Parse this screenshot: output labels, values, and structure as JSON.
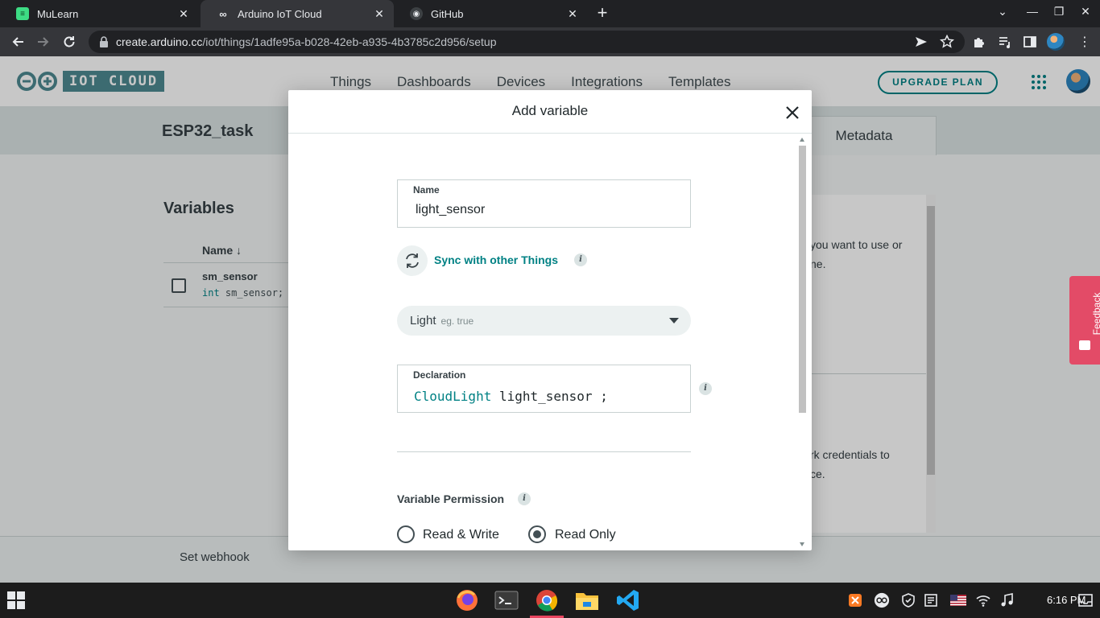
{
  "browser": {
    "tabs": [
      {
        "label": "MuLearn",
        "active": false
      },
      {
        "label": "Arduino IoT Cloud",
        "active": true
      },
      {
        "label": "GitHub",
        "active": false
      }
    ],
    "url_host": "create.arduino.cc",
    "url_path": "/iot/things/1adfe95a-b028-42eb-a935-4b3785c2d956/setup"
  },
  "app": {
    "logo_text": "IOT CLOUD",
    "nav": [
      "Things",
      "Dashboards",
      "Devices",
      "Integrations",
      "Templates"
    ],
    "upgrade_label": "UPGRADE PLAN",
    "accent": "#008184"
  },
  "thing": {
    "title": "ESP32_task",
    "metadata_tab": "Metadata"
  },
  "variables": {
    "title": "Variables",
    "column_name": "Name ↓",
    "rows": [
      {
        "name": "sm_sensor",
        "decl_type": "int",
        "decl_rest": " sm_sensor;"
      }
    ]
  },
  "right_panel": {
    "line1": "you want to use or",
    "line2": "ne.",
    "line3": "rk credentials to",
    "line4": "ce."
  },
  "bottom": {
    "webhook": "Set webhook"
  },
  "feedback": {
    "label": "Feedback"
  },
  "modal": {
    "title": "Add variable",
    "name_label": "Name",
    "name_value": "light_sensor",
    "sync_label": "Sync with other Things",
    "type_value": "Light",
    "type_example": "eg. true",
    "declaration_label": "Declaration",
    "declaration_type": "CloudLight",
    "declaration_name": " light_sensor ;",
    "permission_label": "Variable Permission",
    "permission_options": [
      {
        "label": "Read & Write",
        "checked": false
      },
      {
        "label": "Read Only",
        "checked": true
      }
    ]
  },
  "taskbar": {
    "clock": "6:16 PM"
  }
}
